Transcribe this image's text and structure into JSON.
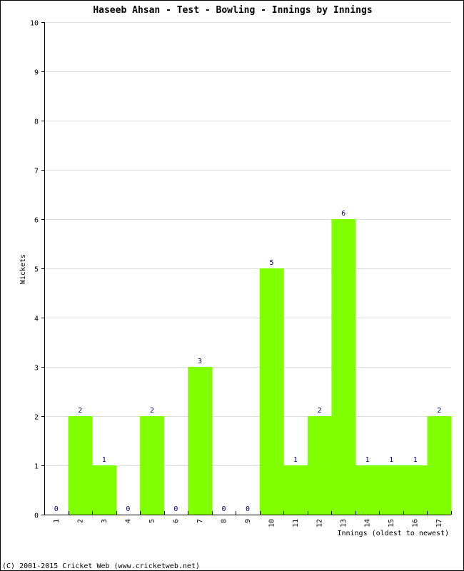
{
  "chart_data": {
    "type": "bar",
    "title": "Haseeb Ahsan - Test - Bowling - Innings by Innings",
    "xlabel": "Innings (oldest to newest)",
    "ylabel": "Wickets",
    "categories": [
      "1",
      "2",
      "3",
      "4",
      "5",
      "6",
      "7",
      "8",
      "9",
      "10",
      "11",
      "12",
      "13",
      "14",
      "15",
      "16",
      "17"
    ],
    "values": [
      0,
      2,
      1,
      0,
      2,
      0,
      3,
      0,
      0,
      5,
      1,
      2,
      6,
      1,
      1,
      1,
      2
    ],
    "ylim": [
      0,
      10
    ],
    "yticks": [
      0,
      1,
      2,
      3,
      4,
      5,
      6,
      7,
      8,
      9,
      10
    ],
    "grid": true,
    "data_labels": true,
    "bar_color": "#80ff00",
    "label_color": "#000080",
    "grid_color": "#dddddd"
  },
  "footer": "(C) 2001-2015 Cricket Web (www.cricketweb.net)"
}
